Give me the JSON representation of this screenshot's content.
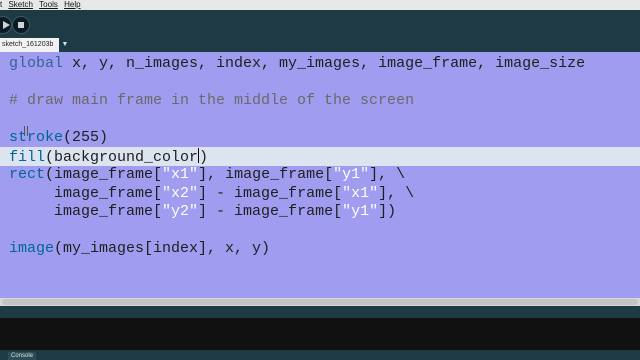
{
  "menubar": {
    "edit_label": "t",
    "sketch_label": "Sketch",
    "tools_label": "Tools",
    "help_label": "Help"
  },
  "tabbar": {
    "tab_label": "sketch_161203b",
    "menu_glyph": "▼"
  },
  "code": {
    "line1": {
      "kw": "global",
      "rest": " x, y, n_images, index, my_images, image_frame, image_size"
    },
    "line3": {
      "comment": "# draw main frame in the middle of the screen"
    },
    "line5": {
      "fn": "stroke",
      "rest": "(255)"
    },
    "line6": {
      "fn": "fill",
      "rest": "(background_color",
      "after_caret": ")"
    },
    "line7": {
      "fn": "rect",
      "p1": "(image_frame[",
      "s1": "\"x1\"",
      "p2": "], image_frame[",
      "s2": "\"y1\"",
      "p3": "], \\"
    },
    "line8": {
      "p1": "     image_frame[",
      "s1": "\"x2\"",
      "p2": "] - image_frame[",
      "s2": "\"x1\"",
      "p3": "], \\"
    },
    "line9": {
      "p1": "     image_frame[",
      "s1": "\"y2\"",
      "p2": "] - image_frame[",
      "s2": "\"y1\"",
      "p3": "])"
    },
    "line11": {
      "fn": "image",
      "rest": "(my_images[index], x, y)"
    }
  },
  "console": {
    "tab_label": "Console"
  },
  "colors": {
    "editor_bg": "#a09cf0",
    "highlight_line": "#dbe4ef",
    "chrome": "#1e3a44",
    "keyword": "#336699",
    "string": "#ffffff",
    "comment": "#6a6a6a"
  },
  "icons": {
    "run": "play-icon",
    "stop": "stop-icon"
  }
}
